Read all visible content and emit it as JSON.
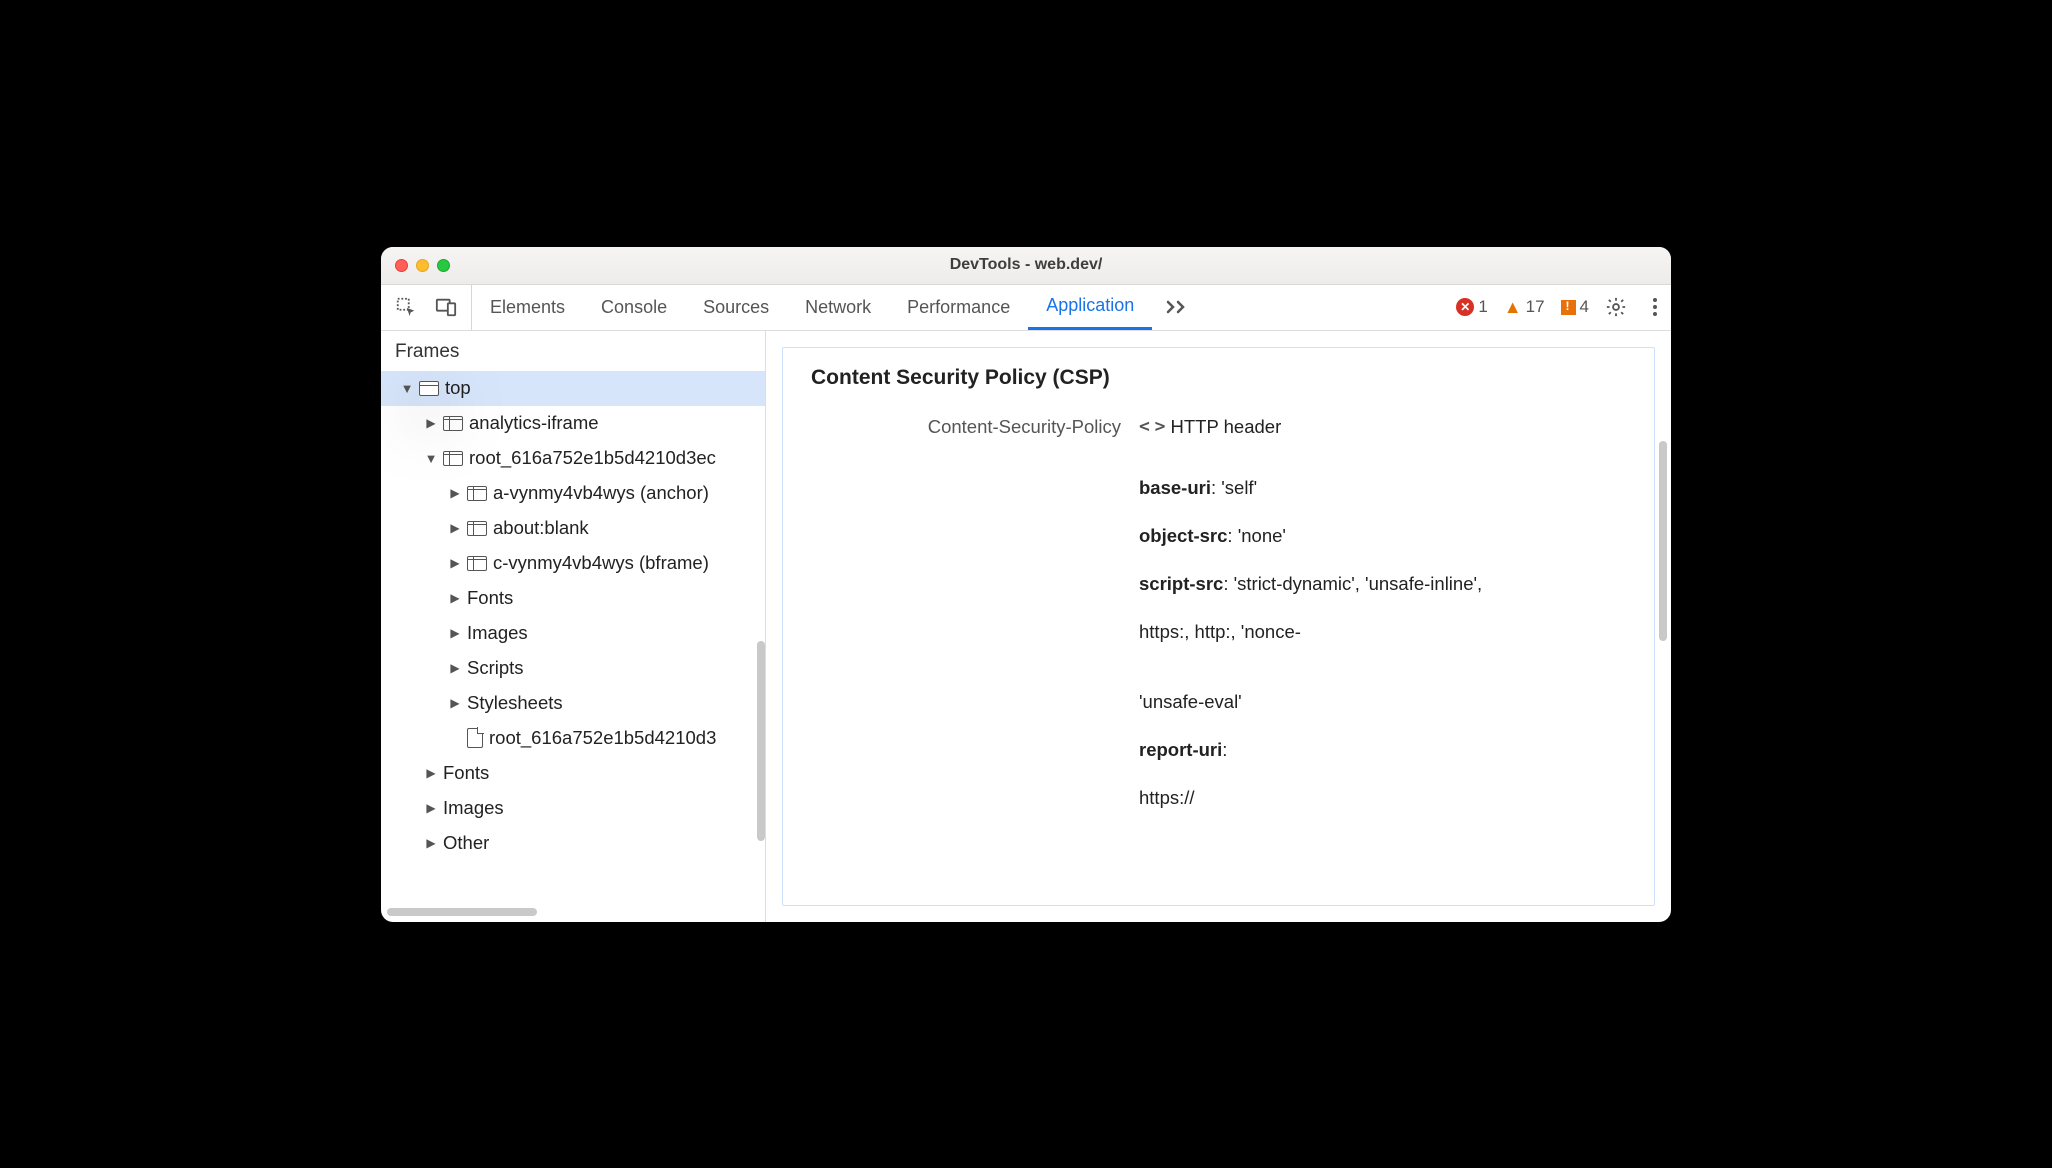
{
  "window": {
    "title": "DevTools - web.dev/"
  },
  "toolbar": {
    "tabs": [
      "Elements",
      "Console",
      "Sources",
      "Network",
      "Performance",
      "Application"
    ],
    "active_tab": "Application",
    "errors": "1",
    "warnings": "17",
    "issues": "4"
  },
  "sidebar": {
    "header": "Frames",
    "tree": {
      "top": "top",
      "l1": [
        "analytics-iframe",
        "root_616a752e1b5d4210d3ec"
      ],
      "l2": [
        "a-vynmy4vb4wys (anchor)",
        "about:blank",
        "c-vynmy4vb4wys (bframe)",
        "Fonts",
        "Images",
        "Scripts",
        "Stylesheets"
      ],
      "doc": "root_616a752e1b5d4210d3",
      "l1b": [
        "Fonts",
        "Images",
        "Other"
      ]
    }
  },
  "main": {
    "heading": "Content Security Policy (CSP)",
    "policy_label": "Content-Security-Policy",
    "policy_source": "HTTP header",
    "directives": [
      {
        "name": "base-uri",
        "value": "'self'"
      },
      {
        "name": "object-src",
        "value": "'none'"
      },
      {
        "name": "script-src",
        "value": "'strict-dynamic', 'unsafe-inline',"
      }
    ],
    "line4": "https:, http:, 'nonce-",
    "line5": "'unsafe-eval'",
    "d4name": "report-uri",
    "d4val": "",
    "line6": "https://"
  }
}
